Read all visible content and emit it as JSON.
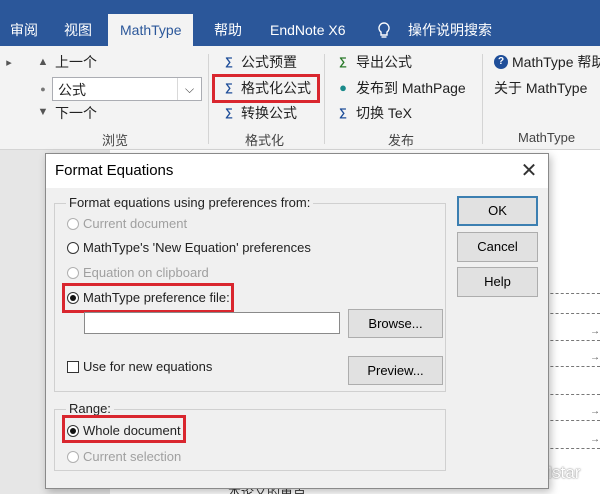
{
  "ribbon": {
    "tabs": [
      "审阅",
      "视图",
      "MathType",
      "帮助",
      "EndNote X6",
      "操作说明搜索"
    ],
    "active_tab": "MathType",
    "browse": {
      "prev_label": "上一个",
      "combo_value": "公式",
      "next_label": "下一个",
      "caption": "浏览"
    },
    "format": {
      "preset_label": "公式预置",
      "format_label": "格式化公式",
      "convert_label": "转换公式",
      "caption": "格式化"
    },
    "publish": {
      "export_label": "导出公式",
      "mathpage_label": "发布到 MathPage",
      "tex_label": "切换 TeX",
      "caption": "发布"
    },
    "mathtype": {
      "help_label": "MathType 帮助",
      "about_label": "关于 MathType",
      "caption": "MathType"
    }
  },
  "dialog": {
    "title": "Format Equations",
    "close_glyph": "✕",
    "prefs_group": {
      "legend": "Format equations using preferences from:",
      "options": [
        {
          "label": "Current document",
          "enabled": false,
          "checked": false
        },
        {
          "label": "MathType's 'New Equation' preferences",
          "enabled": true,
          "checked": false
        },
        {
          "label": "Equation on clipboard",
          "enabled": false,
          "checked": false
        },
        {
          "label": "MathType preference file:",
          "enabled": true,
          "checked": true
        }
      ],
      "file_path": "",
      "browse_button": "Browse...",
      "use_new_label": "Use for new equations",
      "use_new_checked": false,
      "preview_button": "Preview..."
    },
    "range_group": {
      "legend": "Range:",
      "options": [
        {
          "label": "Whole document",
          "enabled": true,
          "checked": true
        },
        {
          "label": "Current selection",
          "enabled": false,
          "checked": false
        }
      ]
    },
    "ok_button": "OK",
    "cancel_button": "Cancel",
    "help_button": "Help"
  },
  "document": {
    "visible_text": "本论文的重点",
    "watermark": "知乎 @Mstar"
  },
  "colors": {
    "ribbon_blue": "#2b579a",
    "highlight_red": "#d9262e",
    "dialog_bg": "#f0f0f0"
  }
}
